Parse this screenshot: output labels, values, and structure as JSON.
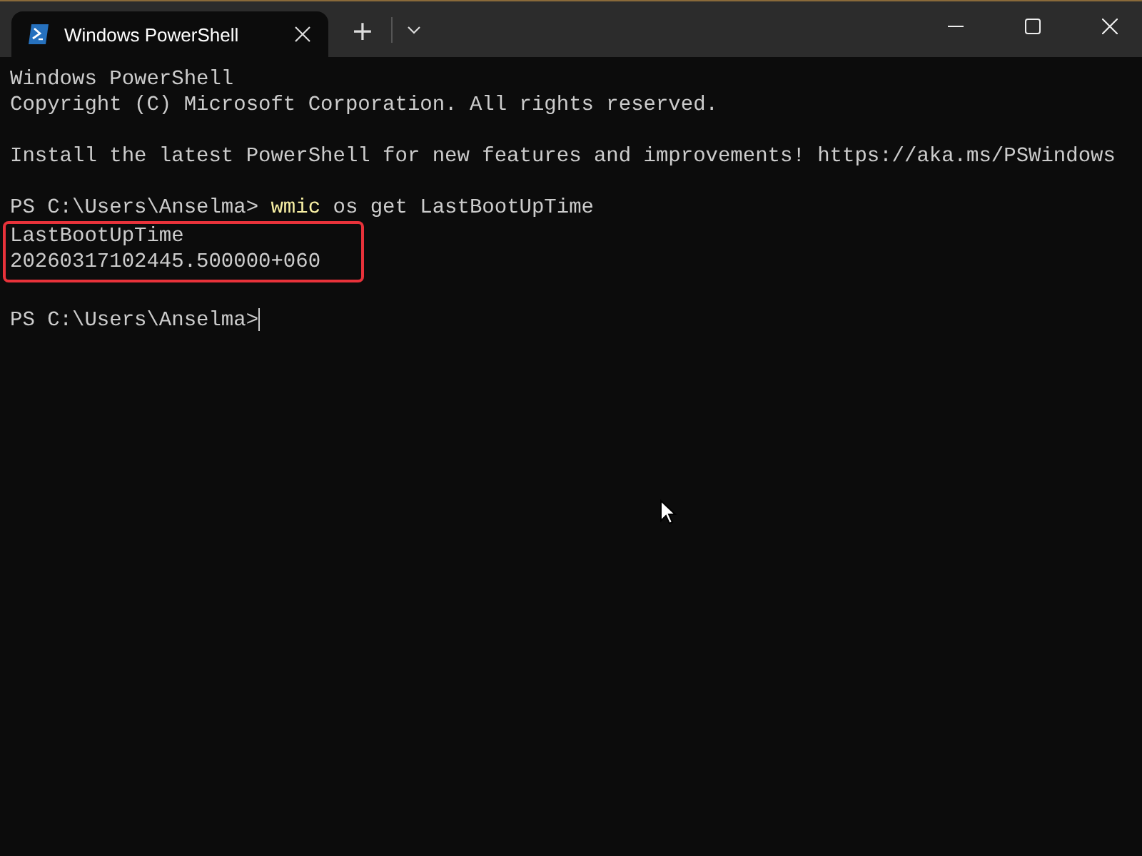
{
  "window": {
    "tab": {
      "title": "Windows PowerShell",
      "selected": true
    },
    "tab_buttons": [
      "+"
    ]
  },
  "console": {
    "blocks": [
      {
        "kind": "text",
        "lines": [
          "Windows PowerShell",
          "Copyright (C) Microsoft Corporation. All rights reserved."
        ]
      },
      {
        "kind": "blank"
      },
      {
        "kind": "text",
        "lines": [
          "Install the latest PowerShell for new features and improvements! https://aka.ms/PSWindows"
        ]
      },
      {
        "kind": "blank"
      },
      {
        "kind": "command",
        "prompt": "PS C:\\Users\\Anselma>",
        "command": "wmic",
        "args": "os get LastBootUpTime"
      },
      {
        "kind": "highlight",
        "lines": [
          "LastBootUpTime",
          "20260317102445.500000+060"
        ]
      },
      {
        "kind": "blank"
      },
      {
        "kind": "input",
        "prompt": "PS C:\\Users\\Anselma>"
      }
    ]
  }
}
